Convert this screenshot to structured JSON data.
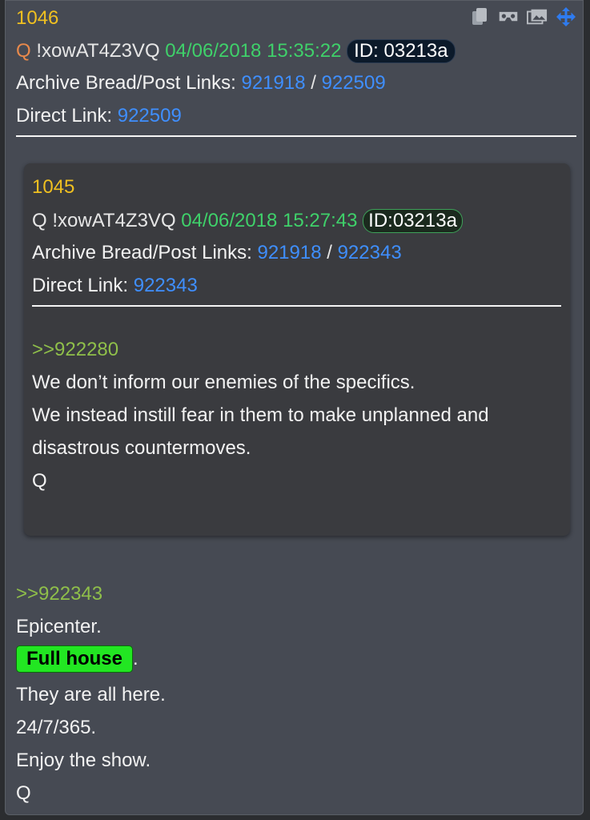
{
  "post": {
    "number": "1046",
    "name": "Q",
    "tripcode": "!xowAT4Z3VQ",
    "datetime": "04/06/2018 15:35:22",
    "id_label": "ID: 03213a",
    "archive_label": "Archive Bread/Post Links:",
    "archive_link_1": "921918",
    "slash": "/",
    "archive_link_2": "922509",
    "direct_label": "Direct Link:",
    "direct_link": "922509",
    "reply_ref": ">>922343",
    "body_lines": [
      "Epicenter.",
      "They are all here.",
      "24/7/365.",
      "Enjoy the show.",
      "Q"
    ],
    "highlight_text": "Full house",
    "highlight_suffix": "."
  },
  "quoted_post": {
    "number": "1045",
    "name": "Q",
    "tripcode": "!xowAT4Z3VQ",
    "datetime": "04/06/2018 15:27:43",
    "id_label": "ID:03213a",
    "archive_label": "Archive Bread/Post Links:",
    "archive_link_1": "921918",
    "slash": "/",
    "archive_link_2": "922343",
    "direct_label": "Direct Link:",
    "direct_link": "922343",
    "reply_ref": ">>922280",
    "body_lines": [
      "We don’t inform our enemies of the specifics.",
      "We instead instill fear in them to make unplanned and",
      "disastrous countermoves.",
      "Q"
    ]
  },
  "icons": [
    "copy-icon",
    "vr-glasses-icon",
    "image-gallery-icon",
    "move-icon"
  ],
  "colors": {
    "background": "#464a53",
    "post_number": "#f0c020",
    "date": "#3fd16a",
    "link": "#3f8fff",
    "reply_ref": "#8fbf4a",
    "highlight": "#22e622"
  }
}
